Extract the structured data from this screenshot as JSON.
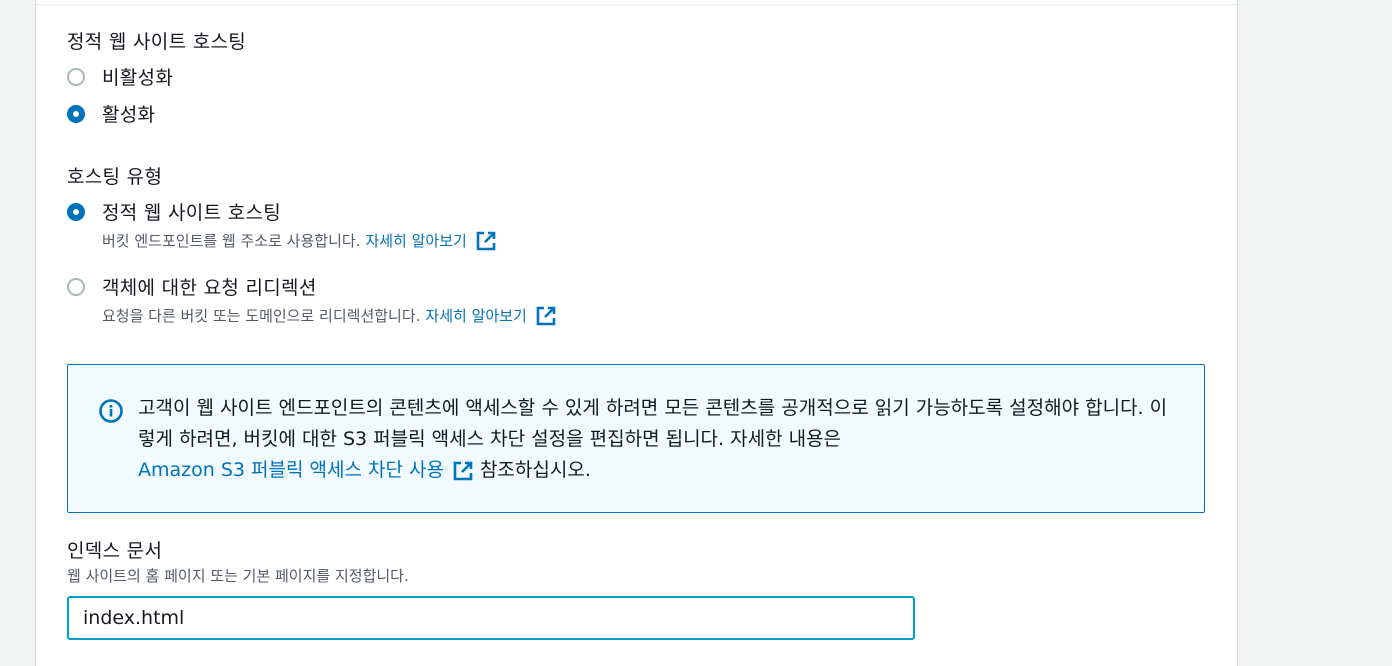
{
  "static_hosting": {
    "label": "정적 웹 사이트 호스팅",
    "options": [
      {
        "label": "비활성화",
        "checked": false
      },
      {
        "label": "활성화",
        "checked": true
      }
    ]
  },
  "hosting_type": {
    "label": "호스팅 유형",
    "options": [
      {
        "label": "정적 웹 사이트 호스팅",
        "desc": "버킷 엔드포인트를 웹 주소로 사용합니다.",
        "link": "자세히 알아보기",
        "checked": true
      },
      {
        "label": "객체에 대한 요청 리디렉션",
        "desc": "요청을 다른 버킷 또는 도메인으로 리디렉션합니다.",
        "link": "자세히 알아보기",
        "checked": false
      }
    ]
  },
  "info": {
    "text1": "고객이 웹 사이트 엔드포인트의 콘텐츠에 액세스할 수 있게 하려면 모든 콘텐츠를 공개적으로 읽기 가능하도록 설정해야 합니다. 이렇게 하려면, 버킷에 대한 S3 퍼블릭 액세스 차단 설정을 편집하면 됩니다. 자세한 내용은",
    "link": "Amazon S3 퍼블릭 액세스 차단 사용",
    "text2": "참조하십시오."
  },
  "index_document": {
    "label": "인덱스 문서",
    "desc": "웹 사이트의 홈 페이지 또는 기본 페이지를 지정합니다.",
    "value": "index.html"
  },
  "colors": {
    "accent": "#0073bb",
    "info_bg": "#f1faff",
    "focus": "#00a1c9"
  }
}
